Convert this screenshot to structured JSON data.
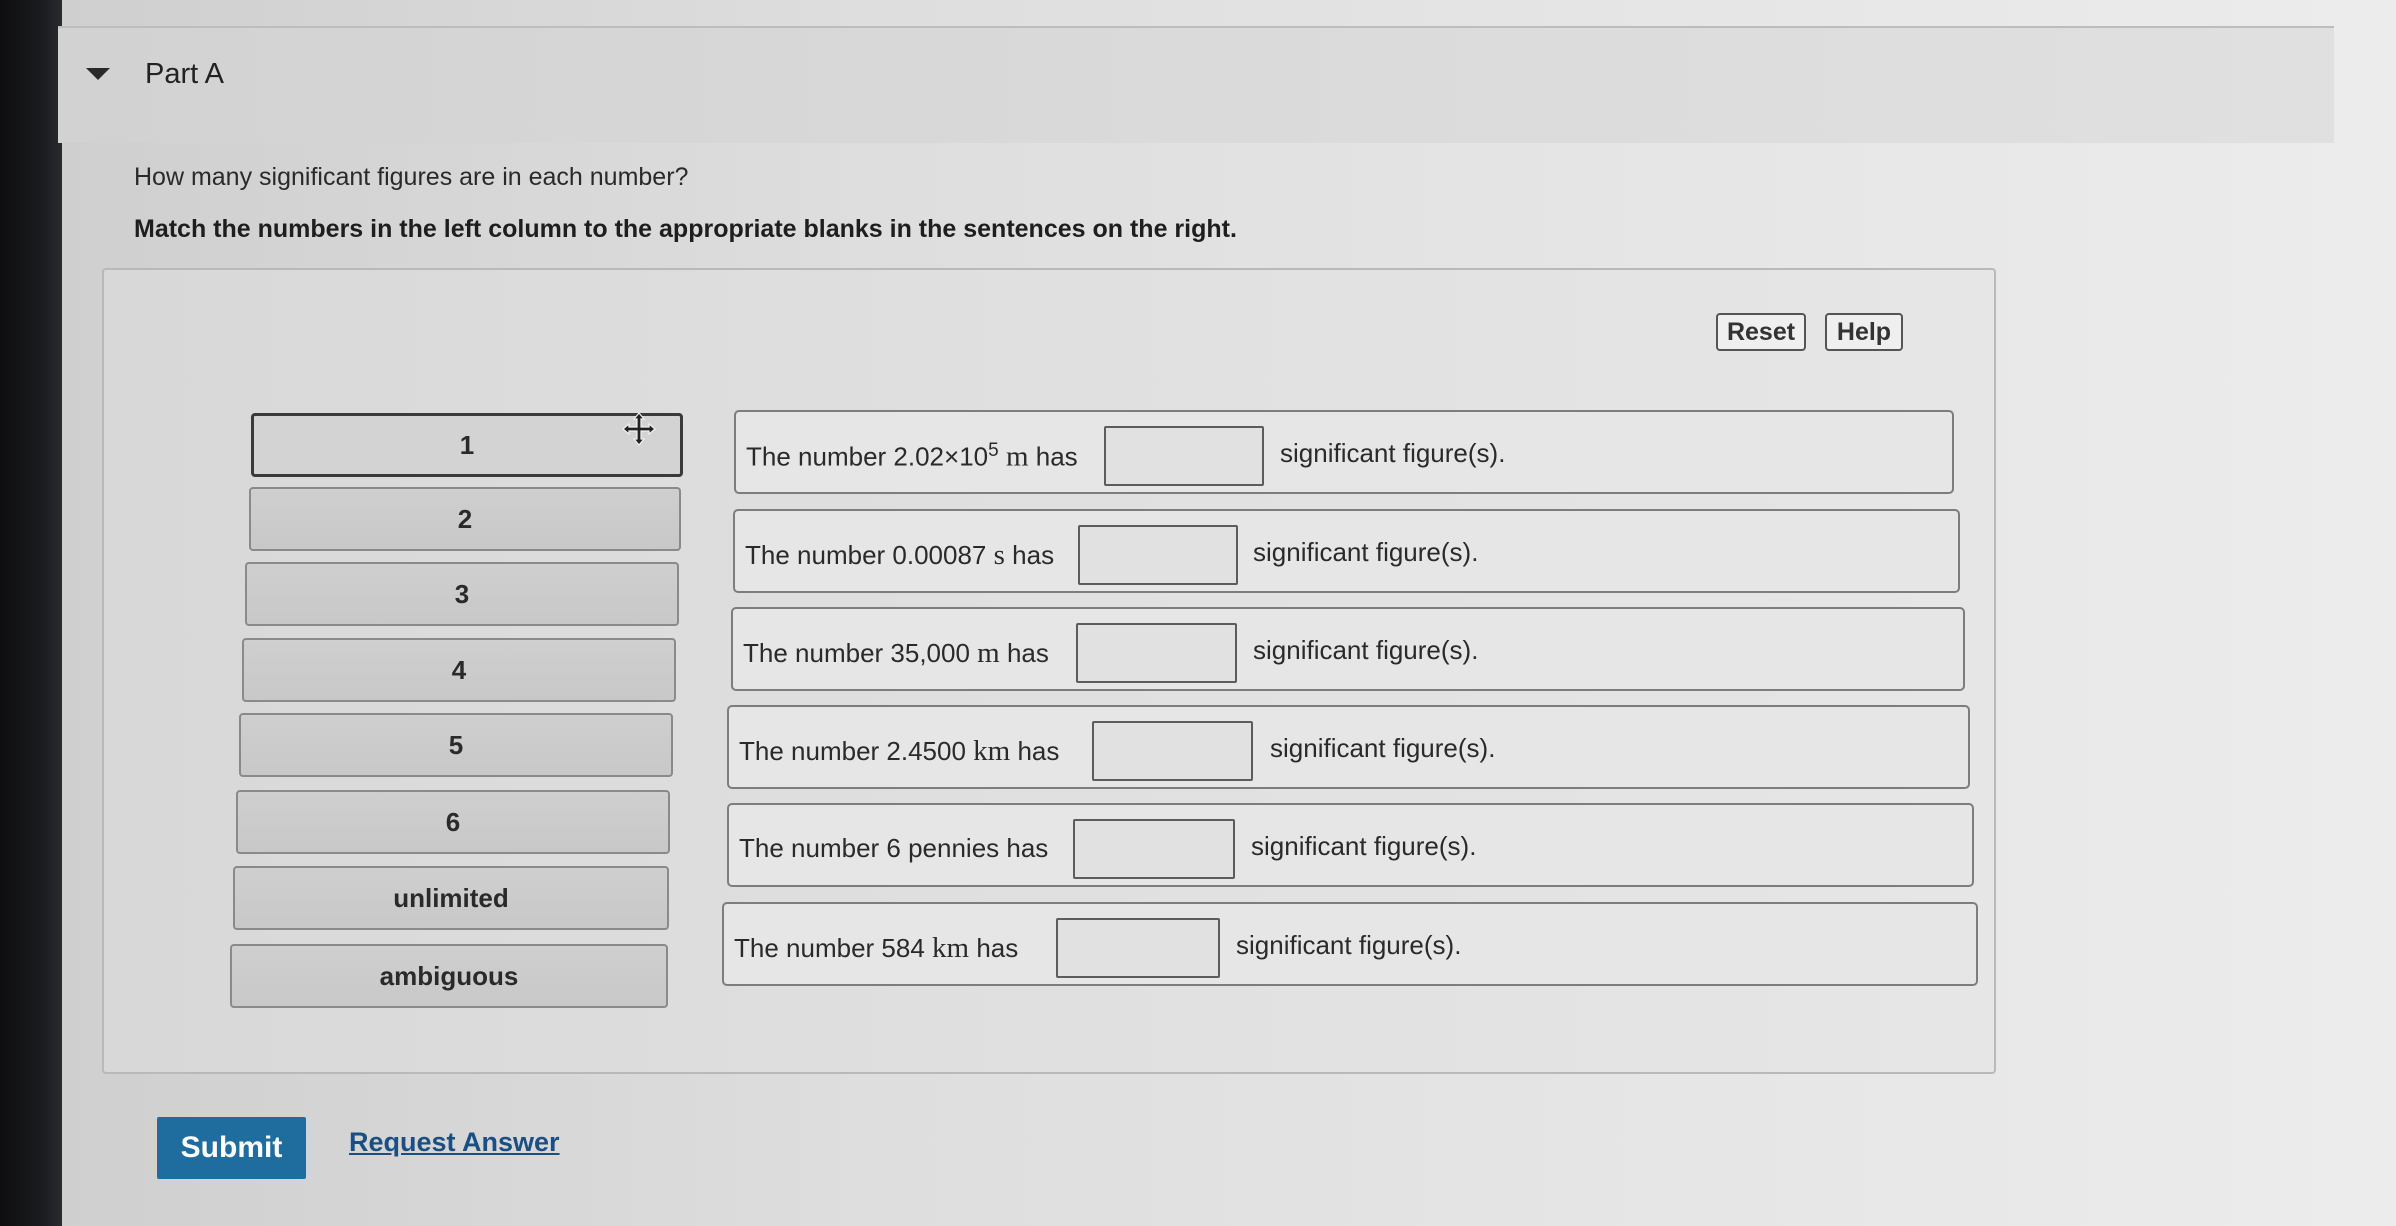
{
  "part": {
    "title": "Part A"
  },
  "question": "How many significant figures are in each number?",
  "instruction": "Match the numbers in the left column to the appropriate blanks in the sentences on the right.",
  "toolbar": {
    "reset_label": "Reset",
    "help_label": "Help"
  },
  "choices": [
    "1",
    "2",
    "3",
    "4",
    "5",
    "6",
    "unlimited",
    "ambiguous"
  ],
  "sentences": [
    {
      "prefix": "The number 2.02×10",
      "exponent": "5",
      "unit": "m",
      "suffix": "has",
      "post": "significant figure(s).",
      "value": ""
    },
    {
      "prefix": "The number 0.00087",
      "unit": "s",
      "suffix": "has",
      "post": "significant figure(s).",
      "value": ""
    },
    {
      "prefix": "The number 35,000",
      "unit": "m",
      "suffix": "has",
      "post": "significant figure(s).",
      "value": ""
    },
    {
      "prefix": "The number 2.4500",
      "unit": "km",
      "suffix": "has",
      "post": "significant figure(s).",
      "value": ""
    },
    {
      "prefix": "The number 6 pennies has",
      "post": "significant figure(s).",
      "value": ""
    },
    {
      "prefix": "The number 584",
      "unit": "km",
      "suffix": "has",
      "post": "significant figure(s).",
      "value": ""
    }
  ],
  "actions": {
    "submit_label": "Submit",
    "request_answer_label": "Request Answer"
  },
  "icons": {
    "collapse": "caret-down-icon",
    "drag": "move-cursor-icon"
  },
  "colors": {
    "submit_bg": "#1f6c9f",
    "link": "#1b4f83"
  }
}
